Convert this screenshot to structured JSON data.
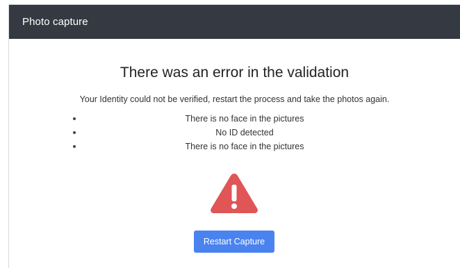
{
  "header": {
    "title": "Photo capture"
  },
  "error": {
    "title": "There was an error in the validation",
    "message": "Your Identity could not be verified, restart the process and take the photos again.",
    "reasons": [
      "There is no face in the pictures",
      "No ID detected",
      "There is no face in the pictures"
    ],
    "icon": "warning-triangle-icon",
    "icon_color": "#e05555"
  },
  "actions": {
    "restart_label": "Restart Capture",
    "button_color": "#4a83ef"
  }
}
